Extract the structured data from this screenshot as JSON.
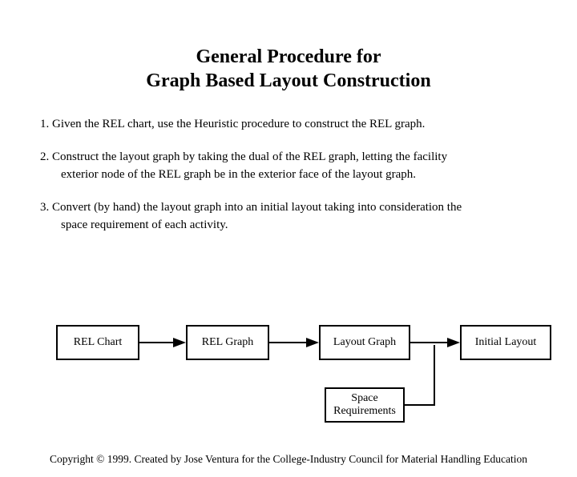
{
  "title_line1": "General Procedure for",
  "title_line2": "Graph Based Layout Construction",
  "steps": {
    "s1_num": "1.",
    "s1_text": "Given the REL chart, use the Heuristic procedure to construct the REL graph.",
    "s2_num": "2.",
    "s2_text": "Construct the layout graph by taking the dual of the REL graph, letting the facility",
    "s2_cont": "exterior node of the REL graph be in the exterior face of the layout graph.",
    "s3_num": "3.",
    "s3_text": "Convert (by hand) the layout graph into an initial layout taking into consideration the",
    "s3_cont": "space requirement of each activity."
  },
  "boxes": {
    "rel_chart": "REL Chart",
    "rel_graph": "REL Graph",
    "layout_graph": "Layout Graph",
    "initial_layout": "Initial Layout",
    "space_req": "Space Requirements"
  },
  "footer": "Copyright © 1999.  Created by Jose Ventura for the College-Industry Council for Material Handling Education"
}
